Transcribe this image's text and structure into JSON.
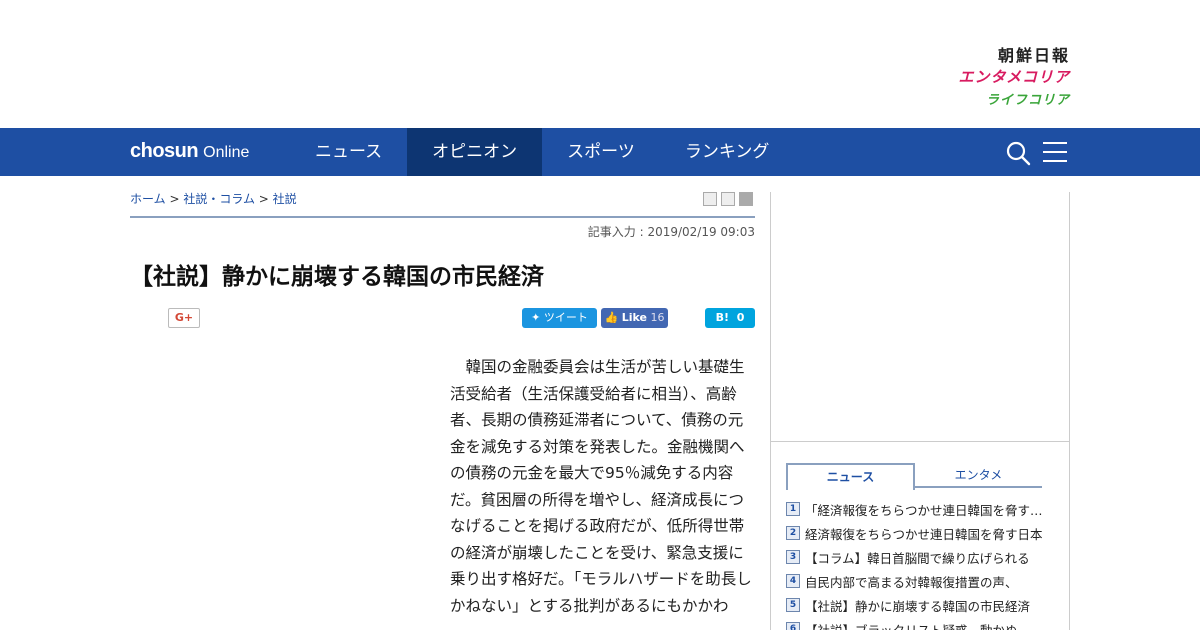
{
  "header": {
    "logo_chosun": "朝鮮日報",
    "logo_entame": "エンタメコリア",
    "logo_life": "ライフコリア"
  },
  "nav": {
    "brand_bold": "chosun",
    "brand_light": "Online",
    "items": [
      {
        "label": "ニュース",
        "active": false
      },
      {
        "label": "オピニオン",
        "active": true
      },
      {
        "label": "スポーツ",
        "active": false
      },
      {
        "label": "ランキング",
        "active": false
      }
    ],
    "search_icon": "search-icon",
    "menu_icon": "hamburger-icon"
  },
  "breadcrumb": {
    "home": "ホーム",
    "section": "社説・コラム",
    "sub": "社説",
    "separator": " > "
  },
  "article": {
    "date": "記事入力 : 2019/02/19 09:03",
    "headline": "【社説】静かに崩壊する韓国の市民経済",
    "body": "韓国の金融委員会は生活が苦しい基礎生活受給者（生活保護受給者に相当）、高齢者、長期の債務延滞者について、債務の元金を減免する対策を発表した。金融機関への債務の元金を最大で95％減免する内容だ。貧困層の所得を増やし、経済成長につなげることを掲げる政府だが、低所得世帯の経済が崩壊したことを受け、緊急支援に乗り出す格好だ。「モラルハザードを助長しかねない」とする批判があるにもかかわ"
  },
  "social": {
    "gplus": "G+",
    "tweet": "ツイート",
    "like": "Like",
    "like_count": "16",
    "hatena": "B!",
    "hatena_count": "0"
  },
  "sidebar": {
    "tabs": [
      {
        "label": "ニュース",
        "active": true
      },
      {
        "label": "エンタメ",
        "active": false
      }
    ],
    "ranking": [
      {
        "num": "1",
        "text": "「経済報復をちらつかせ連日韓国を脅す日本"
      },
      {
        "num": "2",
        "text": "経済報復をちらつかせ連日韓国を脅す日本"
      },
      {
        "num": "3",
        "text": "【コラム】韓日首脳間で繰り広げられる"
      },
      {
        "num": "4",
        "text": "自民内部で高まる対韓報復措置の声、"
      },
      {
        "num": "5",
        "text": "【社説】静かに崩壊する韓国の市民経済"
      },
      {
        "num": "6",
        "text": "【社説】ブラックリスト疑惑、動かぬ"
      }
    ]
  },
  "colors": {
    "nav_bg": "#1e4fa3",
    "nav_active": "#0d3572",
    "entame": "#d81b60",
    "life": "#3aa53a"
  }
}
